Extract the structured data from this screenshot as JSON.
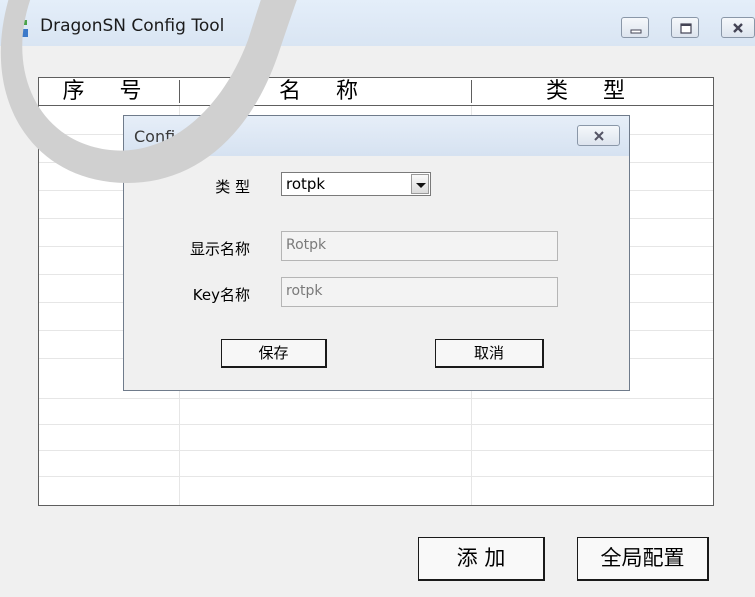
{
  "window": {
    "title": "DragonSN Config Tool",
    "icon": "app-cubes-icon"
  },
  "table": {
    "columns": [
      "序 号",
      "名 称",
      "类 型"
    ],
    "rows": []
  },
  "toolbar": {
    "add_label": "添 加",
    "global_config_label": "全局配置"
  },
  "dialog": {
    "title": "Config Item",
    "type_label": "类 型",
    "type_value": "rotpk",
    "display_name_label": "显示名称",
    "display_name_value": "Rotpk",
    "key_name_label": "Key名称",
    "key_name_value": "rotpk",
    "save_label": "保存",
    "cancel_label": "取消"
  },
  "colors": {
    "titlebar": "#dce7f4",
    "background": "#f0f0f0",
    "table_bg": "#ffffff"
  }
}
